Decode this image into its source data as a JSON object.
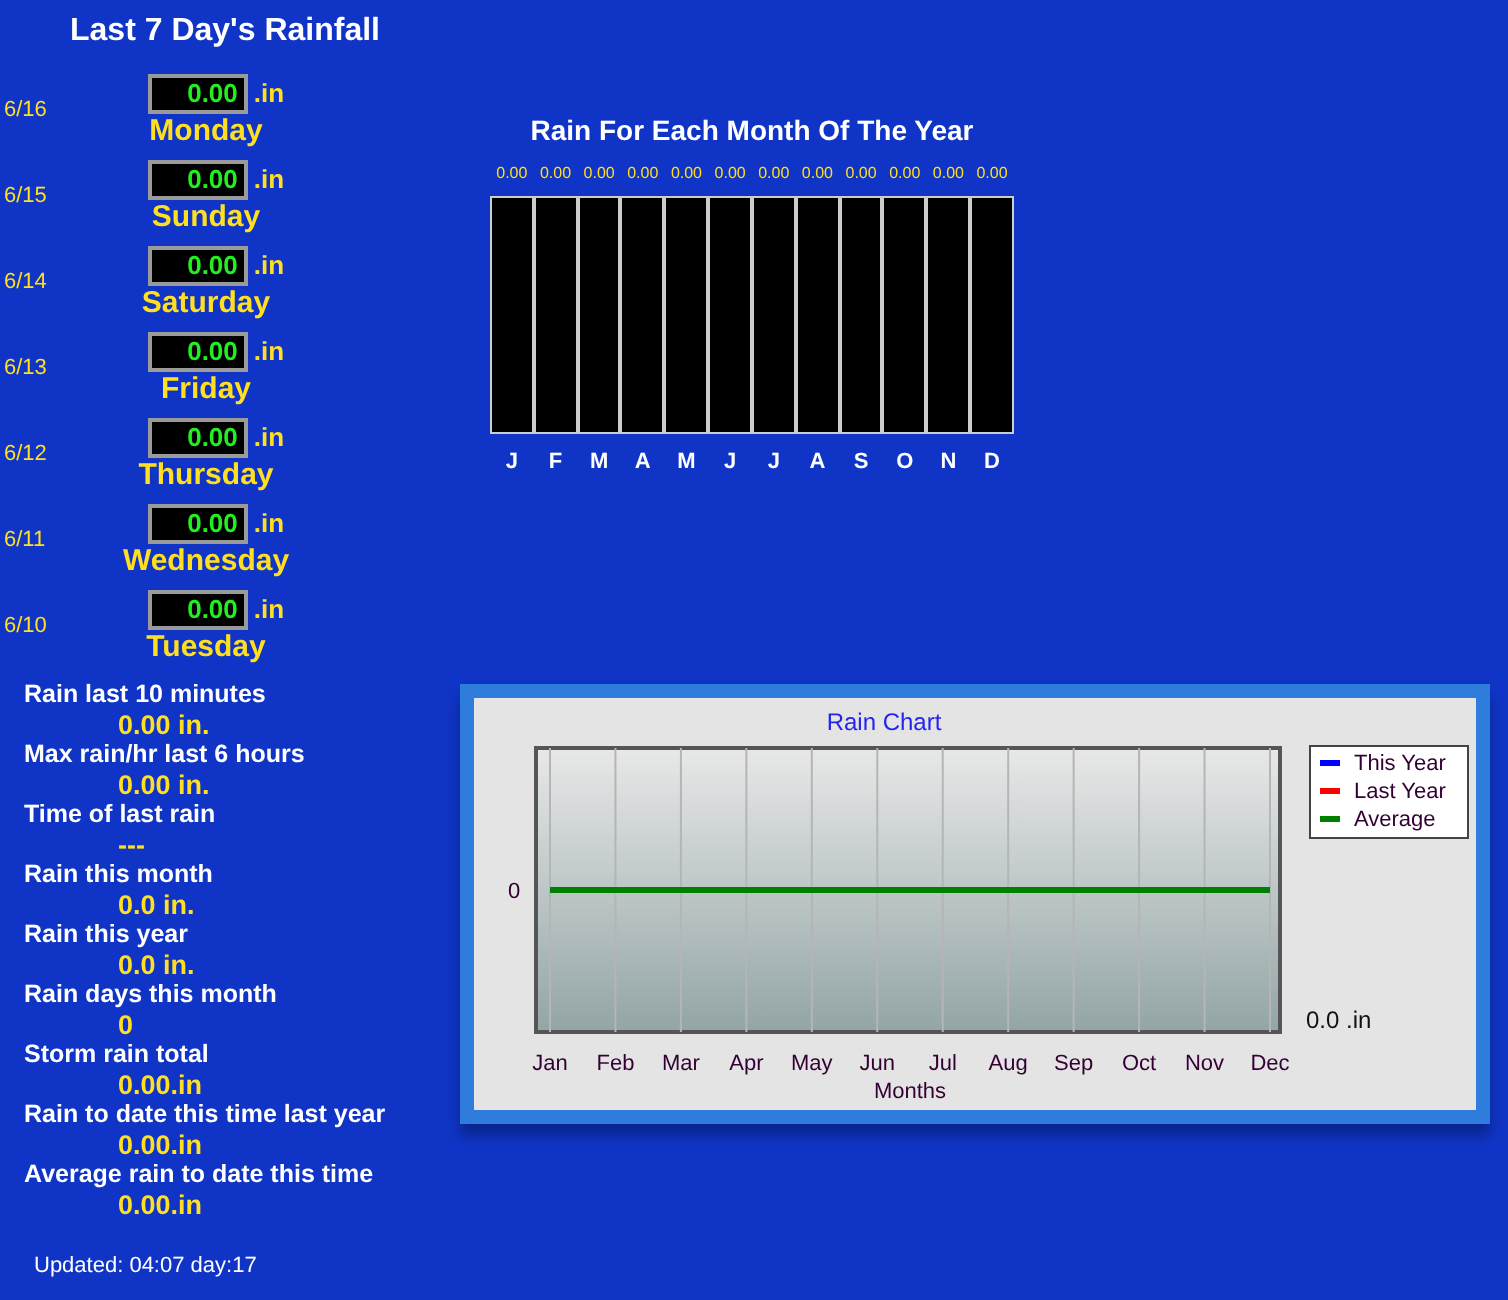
{
  "title": "Last 7 Day's Rainfall",
  "days": [
    {
      "date": "6/16",
      "value": "0.00",
      "unit": ".in",
      "name": "Monday"
    },
    {
      "date": "6/15",
      "value": "0.00",
      "unit": ".in",
      "name": "Sunday"
    },
    {
      "date": "6/14",
      "value": "0.00",
      "unit": ".in",
      "name": "Saturday"
    },
    {
      "date": "6/13",
      "value": "0.00",
      "unit": ".in",
      "name": "Friday"
    },
    {
      "date": "6/12",
      "value": "0.00",
      "unit": ".in",
      "name": "Thursday"
    },
    {
      "date": "6/11",
      "value": "0.00",
      "unit": ".in",
      "name": "Wednesday"
    },
    {
      "date": "6/10",
      "value": "0.00",
      "unit": ".in",
      "name": "Tuesday"
    }
  ],
  "stats": [
    {
      "label": "Rain last 10 minutes",
      "value": "0.00 in."
    },
    {
      "label": "Max rain/hr last 6 hours",
      "value": "0.00 in."
    },
    {
      "label": "Time of last rain",
      "value": "---"
    },
    {
      "label": "Rain this month",
      "value": "0.0 in."
    },
    {
      "label": "Rain this year",
      "value": "0.0 in."
    },
    {
      "label": "Rain days this month",
      "value": "0"
    },
    {
      "label": "Storm rain total",
      "value": "0.00.in"
    },
    {
      "label": "Rain to date this time last year",
      "value": "0.00.in"
    },
    {
      "label": "Average rain to date this time",
      "value": "0.00.in"
    }
  ],
  "updated": "Updated: 04:07 day:17",
  "monthly": {
    "title": "Rain For Each Month Of The Year",
    "months": [
      {
        "label": "J",
        "value": "0.00"
      },
      {
        "label": "F",
        "value": "0.00"
      },
      {
        "label": "M",
        "value": "0.00"
      },
      {
        "label": "A",
        "value": "0.00"
      },
      {
        "label": "M",
        "value": "0.00"
      },
      {
        "label": "J",
        "value": "0.00"
      },
      {
        "label": "J",
        "value": "0.00"
      },
      {
        "label": "A",
        "value": "0.00"
      },
      {
        "label": "S",
        "value": "0.00"
      },
      {
        "label": "O",
        "value": "0.00"
      },
      {
        "label": "N",
        "value": "0.00"
      },
      {
        "label": "D",
        "value": "0.00"
      }
    ]
  },
  "rain_chart": {
    "total_label": "0.0 .in",
    "legend": [
      {
        "name": "This Year",
        "color": "#0000ff"
      },
      {
        "name": "Last Year",
        "color": "#ff0000"
      },
      {
        "name": "Average",
        "color": "#008000"
      }
    ],
    "title": "Rain Chart",
    "x_axis_title": "Months",
    "y_axis_label": "0",
    "months": [
      "Jan",
      "Feb",
      "Mar",
      "Apr",
      "May",
      "Jun",
      "Jul",
      "Aug",
      "Sep",
      "Oct",
      "Nov",
      "Dec"
    ]
  }
}
